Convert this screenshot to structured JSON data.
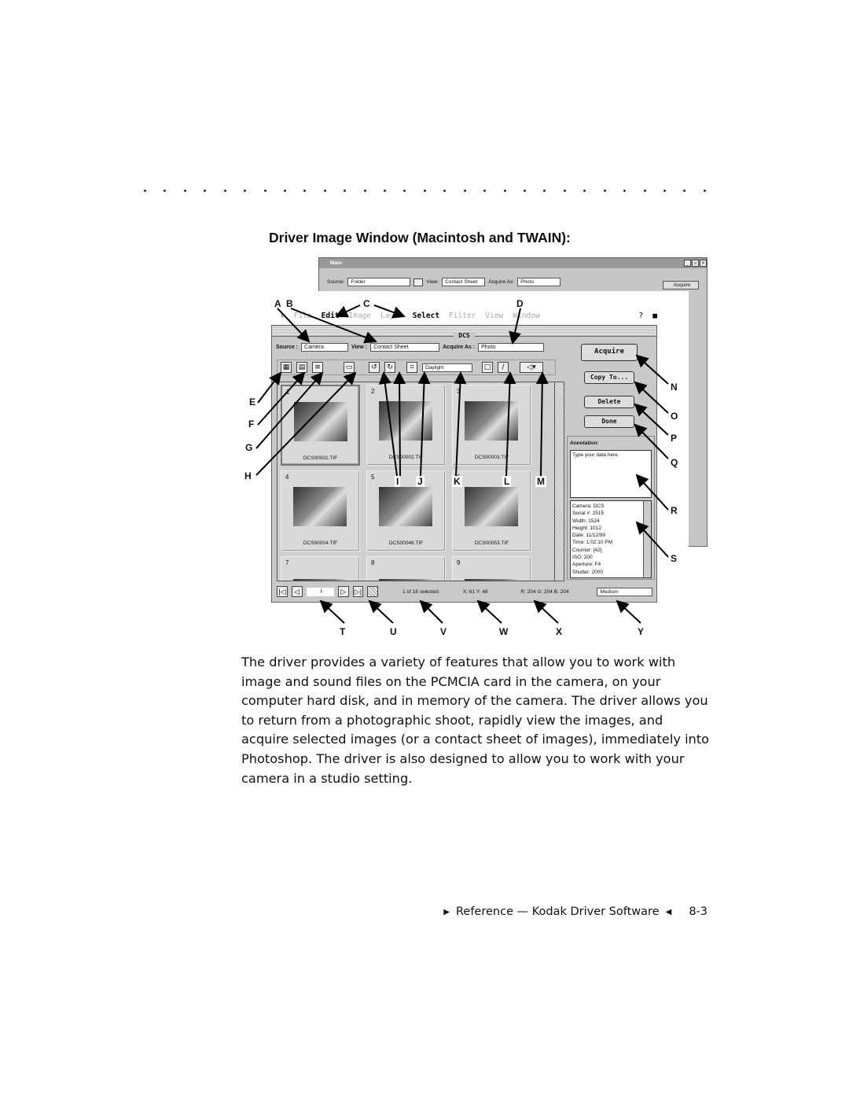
{
  "heading": "Driver Image Window (Macintosh and TWAIN):",
  "figure": {
    "back_window": {
      "title": "Main",
      "source_label": "Source:",
      "source_value": "Folder",
      "view_label": "View:",
      "view_value": "Contact Sheet",
      "acquire_as_label": "Acquire As:",
      "acquire_as_value": "Photo",
      "acquire_button": "Acquire"
    },
    "menu": [
      "File",
      "Edit",
      "Image",
      "Layer",
      "Select",
      "Filter",
      "View",
      "Window"
    ],
    "dcs": {
      "title": "DCS",
      "source_label": "Source :",
      "source_value": "Camera",
      "view_label": "View :",
      "view_value": "Contact Sheet",
      "acquire_as_label": "Acquire As :",
      "acquire_as_value": "Photo",
      "white_balance": "Daylight",
      "buttons": {
        "acquire": "Acquire",
        "copy_to": "Copy To...",
        "delete": "Delete",
        "done": "Done"
      },
      "thumbnails": [
        {
          "n": "1",
          "file": "DCS00001.TIF"
        },
        {
          "n": "2",
          "file": "DCS00002.TIF"
        },
        {
          "n": "3",
          "file": "DCS00003.TIF"
        },
        {
          "n": "4",
          "file": "DCS00004.TIF"
        },
        {
          "n": "5",
          "file": "DCS00046.TIF"
        },
        {
          "n": "6",
          "file": "DCS00053.TIF"
        },
        {
          "n": "7",
          "file": ""
        },
        {
          "n": "8",
          "file": ""
        },
        {
          "n": "9",
          "file": ""
        }
      ],
      "annotation_label": "Annotation:",
      "annotation_text": "Type your data here.",
      "info": [
        "Camera:  DCS",
        "Serial #:  2515",
        "Width:   1524",
        "Height:  1012",
        "Date:   11/12/99",
        "Time:   1:02:10 PM",
        "Counter:   [42]",
        "ISO:      200",
        "Aperture:  F4",
        "Shutter:   2000"
      ],
      "page_value": "1",
      "selection_status": "1 of 18 selected",
      "coords": "X: 61  Y: 48",
      "rgb": "R: 204  G: 204  B: 204",
      "size_value": "Medium"
    },
    "callouts": {
      "A": "A",
      "B": "B",
      "C": "C",
      "D": "D",
      "E": "E",
      "F": "F",
      "G": "G",
      "H": "H",
      "I": "I",
      "J": "J",
      "K": "K",
      "L": "L",
      "M": "M",
      "N": "N",
      "O": "O",
      "P": "P",
      "Q": "Q",
      "R": "R",
      "S": "S",
      "T": "T",
      "U": "U",
      "V": "V",
      "W": "W",
      "X": "X",
      "Y": "Y"
    }
  },
  "body": "The driver provides a variety of features that allow you to work with image and sound files on the PCMCIA card in the camera, on your computer hard disk, and in memory of the camera. The driver allows you to return from a photographic shoot, rapidly view the images, and acquire selected images (or a contact sheet of images), immediately into Photoshop. The driver is also designed to allow you to work with your camera in a studio setting.",
  "footer": {
    "text": "Reference — Kodak Driver Software",
    "page": "8-3"
  }
}
